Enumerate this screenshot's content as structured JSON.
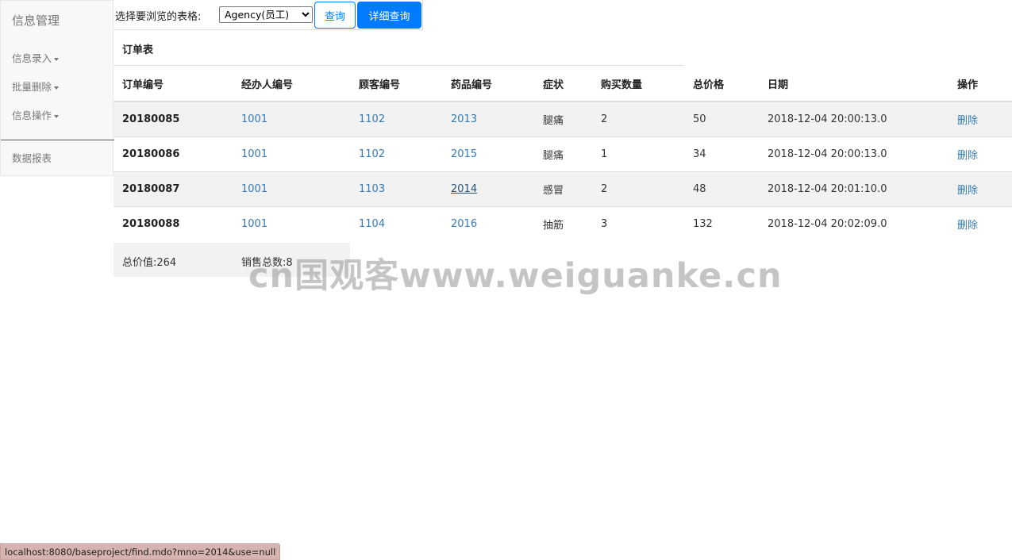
{
  "sidebar": {
    "brand": "信息管理",
    "items": [
      {
        "label": "信息录入"
      },
      {
        "label": "批量删除"
      },
      {
        "label": "信息操作"
      }
    ],
    "report_label": "数据报表"
  },
  "toolbar": {
    "select_label": "选择要浏览的表格:",
    "selected_table": "Agency(员工)",
    "query_label": "查询",
    "detail_query_label": "详细查询"
  },
  "table": {
    "title": "订单表",
    "columns": [
      "订单编号",
      "经办人编号",
      "顾客编号",
      "药品编号",
      "症状",
      "购买数量",
      "总价格",
      "日期",
      "操作"
    ],
    "rows": [
      {
        "order_id": "20180085",
        "agent_id": "1001",
        "customer_id": "1102",
        "drug_id": "2013",
        "symptom": "腿痛",
        "quantity": "2",
        "total_price": "50",
        "date": "2018-12-04 20:00:13.0",
        "action": "删除"
      },
      {
        "order_id": "20180086",
        "agent_id": "1001",
        "customer_id": "1102",
        "drug_id": "2015",
        "symptom": "腿痛",
        "quantity": "1",
        "total_price": "34",
        "date": "2018-12-04 20:00:13.0",
        "action": "删除"
      },
      {
        "order_id": "20180087",
        "agent_id": "1001",
        "customer_id": "1103",
        "drug_id": "2014",
        "symptom": "感冒",
        "quantity": "2",
        "total_price": "48",
        "date": "2018-12-04 20:01:10.0",
        "action": "删除"
      },
      {
        "order_id": "20180088",
        "agent_id": "1001",
        "customer_id": "1104",
        "drug_id": "2016",
        "symptom": "抽筋",
        "quantity": "3",
        "total_price": "132",
        "date": "2018-12-04 20:02:09.0",
        "action": "删除"
      }
    ]
  },
  "summary": {
    "total_value": "总价值:264",
    "total_sales": "销售总数:8"
  },
  "watermark": "cn国观客www.weiguanke.cn",
  "status_url": "localhost:8080/baseproject/find.mdo?mno=2014&use=null",
  "colors": {
    "link": "#337ab7",
    "primary": "#007bff",
    "stripe": "#f2f2f2",
    "statusbar": "#d8b4b0"
  }
}
